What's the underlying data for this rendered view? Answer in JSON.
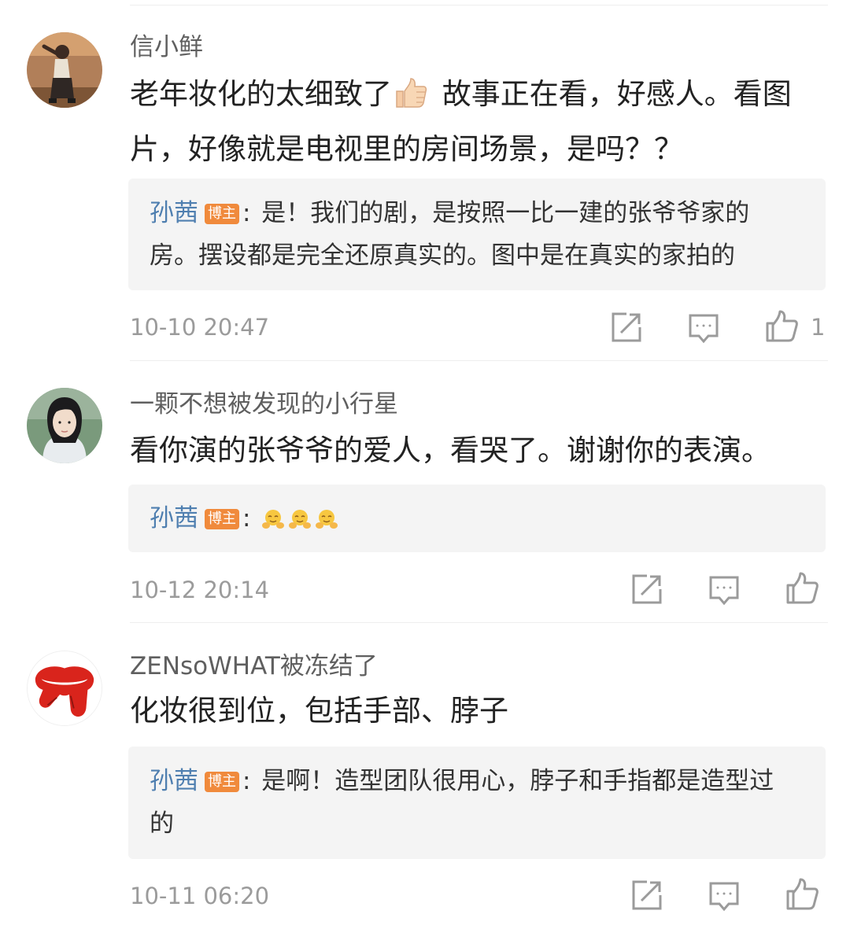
{
  "comments": [
    {
      "username": "信小鲜",
      "text_before_emoji": "老年妆化的太细致了",
      "text_emoji": "thumbs-up-emoji",
      "text_after_emoji": " 故事正在看，好感人。看图片，好像就是电视里的房间场景，是吗？？",
      "reply": {
        "author": "孙茜",
        "badge": "博主",
        "separator": ":",
        "text": " 是！我们的剧，是按照一比一建的张爷爷家的房。摆设都是完全还原真实的。图中是在真实的家拍的"
      },
      "time": "10-10 20:47",
      "like_count": "1"
    },
    {
      "username": "一颗不想被发现的小行星",
      "text": "看你演的张爷爷的爱人，看哭了。谢谢你的表演。",
      "reply": {
        "author": "孙茜",
        "badge": "博主",
        "separator": ":",
        "emojis": [
          "hug-emoji",
          "hug-emoji",
          "hug-emoji"
        ]
      },
      "time": "10-12 20:14",
      "like_count": ""
    },
    {
      "username": "ZENsoWHAT被冻结了",
      "text": "化妆很到位，包括手部、脖子",
      "reply": {
        "author": "孙茜",
        "badge": "博主",
        "separator": ":",
        "text": " 是啊！造型团队很用心，脖子和手指都是造型过的"
      },
      "time": "10-11 06:20",
      "like_count": ""
    }
  ],
  "actions": [
    "share-icon",
    "comment-icon",
    "like-icon"
  ],
  "colors": {
    "reply_author": "#4f7fb0",
    "badge": "#f08a3c",
    "reply_background": "#f4f4f4",
    "meta_text": "#9b9b9b"
  }
}
